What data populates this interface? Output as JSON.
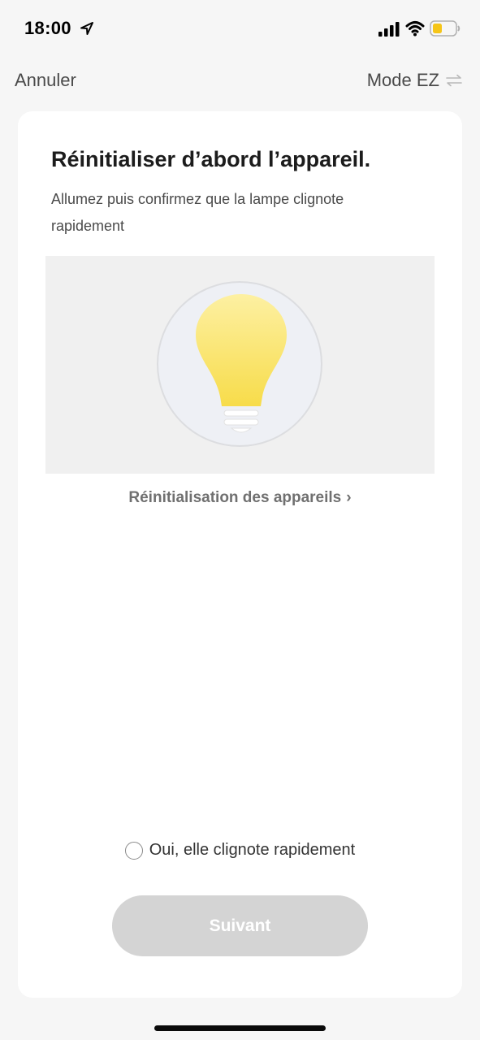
{
  "status_bar": {
    "time": "18:00",
    "icons": [
      "location-arrow-icon",
      "cellular-signal-icon",
      "wifi-icon",
      "battery-icon"
    ],
    "battery_color": "#f5c518"
  },
  "nav": {
    "cancel_label": "Annuler",
    "mode_label": "Mode EZ",
    "mode_icon": "swap-arrows-icon"
  },
  "card": {
    "title": "Réinitialiser d’abord l’appareil.",
    "description": "Allumez puis confirmez que la lampe clignote rapidement",
    "illustration_icon": "light-bulb-icon",
    "reset_link_label": "Réinitialisation des appareils",
    "reset_link_chevron": "›",
    "confirm_label": "Oui, elle clignote rapidement",
    "confirm_checked": false,
    "next_button_label": "Suivant",
    "next_button_enabled": false
  },
  "colors": {
    "background": "#f6f6f6",
    "card": "#ffffff",
    "bulb_yellow": "#f7e04f",
    "button_disabled": "#d4d4d4"
  }
}
